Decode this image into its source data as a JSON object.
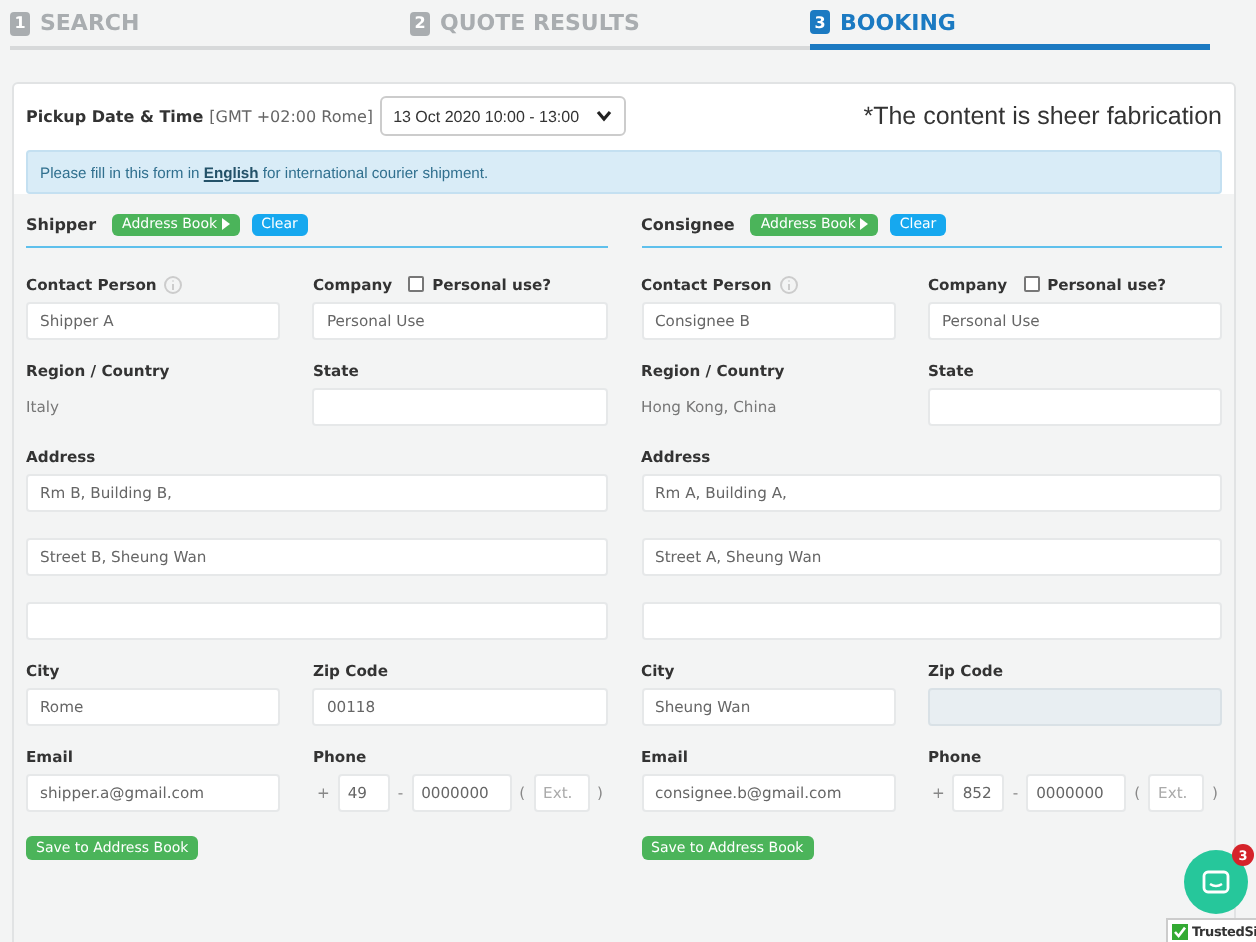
{
  "steps": [
    {
      "number": "1",
      "label": "SEARCH",
      "selected": false
    },
    {
      "number": "2",
      "label": "QUOTE RESULTS",
      "selected": false
    },
    {
      "number": "3",
      "label": "BOOKING",
      "selected": true
    }
  ],
  "note": "*The content is sheer fabrication",
  "pickup": {
    "label": "Pickup Date & Time",
    "timezone": "[GMT +02:00 Rome]",
    "value": "13 Oct 2020 10:00 - 13:00"
  },
  "notice": {
    "before": "Please fill in this form in",
    "link": "English",
    "after": "for international courier shipment."
  },
  "parties": [
    {
      "title": "Shipper",
      "address_book": "Address Book",
      "clear": "Clear",
      "contact_label": "Contact Person",
      "contact": "Shipper A",
      "company_label": "Company",
      "personal_use": {
        "label": "Personal use?",
        "checked": false
      },
      "company": "Personal Use",
      "region_label": "Region / Country",
      "region": "Italy",
      "state_label": "State",
      "address_label": "Address",
      "address": [
        "Rm B, Building B,",
        "Street B, Sheung Wan"
      ],
      "city_label": "City",
      "city": "Rome",
      "zip_label": "Zip Code",
      "zip": "00118",
      "zip_disabled": false,
      "email_label": "Email",
      "email": "shipper.a@gmail.com",
      "phone_label": "Phone",
      "phone_plus": "+",
      "phone_code": "49",
      "phone_dash": "-",
      "phone_number": "0000000",
      "ext_open": "(",
      "ext_placeholder": "Ext.",
      "ext_close": ")",
      "save": "Save to Address Book"
    },
    {
      "title": "Consignee",
      "address_book": "Address Book",
      "clear": "Clear",
      "contact_label": "Contact Person",
      "contact": "Consignee B",
      "company_label": "Company",
      "personal_use": {
        "label": "Personal use?",
        "checked": false
      },
      "company": "Personal Use",
      "region_label": "Region / Country",
      "region": "Hong Kong, China",
      "state_label": "State",
      "address_label": "Address",
      "address": [
        "Rm A, Building A,",
        "Street A, Sheung Wan"
      ],
      "city_label": "City",
      "city": "Sheung Wan",
      "zip_label": "Zip Code",
      "zip_disabled": true,
      "email_label": "Email",
      "email": "consignee.b@gmail.com",
      "phone_label": "Phone",
      "phone_plus": "+",
      "phone_code": "852",
      "phone_dash": "-",
      "phone_number": "0000000",
      "ext_open": "(",
      "ext_placeholder": "Ext.",
      "ext_close": ")",
      "save": "Save to Address Book"
    }
  ],
  "chat": {
    "badge": "3"
  },
  "trusted_badge": "TrustedSi"
}
